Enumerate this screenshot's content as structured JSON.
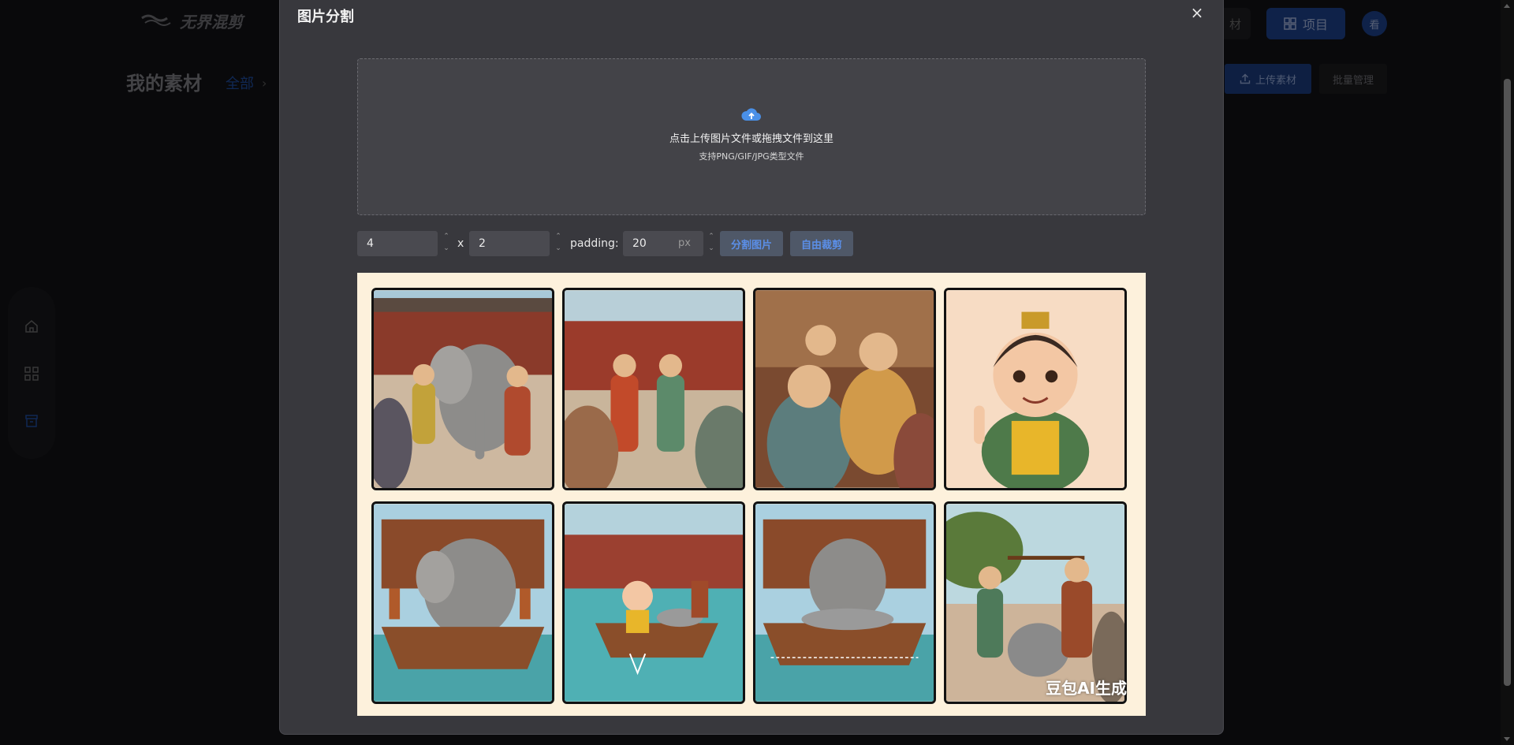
{
  "app": {
    "logo_text": "无界混剪",
    "page_title": "我的素材",
    "breadcrumb_all": "全部",
    "materials_btn_partial": "材",
    "project_btn": "项目",
    "avatar_text": "看",
    "upload_btn": "上传素材",
    "batch_btn": "批量管理"
  },
  "modal": {
    "title": "图片分割",
    "close": "×",
    "dropzone": {
      "main_text": "点击上传图片文件或拖拽文件到这里",
      "sub_text": "支持PNG/GIF/JPG类型文件"
    },
    "controls": {
      "cols": "4",
      "times": "x",
      "rows": "2",
      "padding_label": "padding:",
      "padding_value": "20",
      "padding_unit": "px",
      "split_btn": "分割图片",
      "free_crop_btn": "自由裁剪"
    },
    "preview": {
      "watermark": "豆包AI生成",
      "tiles": [
        {
          "scene": "elephant-in-courtyard"
        },
        {
          "scene": "officials-gathering"
        },
        {
          "scene": "officials-discussing"
        },
        {
          "scene": "boy-raising-finger"
        },
        {
          "scene": "elephant-on-boat"
        },
        {
          "scene": "boy-marking-boat"
        },
        {
          "scene": "boat-with-stones"
        },
        {
          "scene": "weighing-stones"
        }
      ]
    }
  },
  "colors": {
    "accent_blue": "#2f6fe0",
    "modal_bg": "#38383d",
    "preview_bg": "#fdf1dc"
  }
}
